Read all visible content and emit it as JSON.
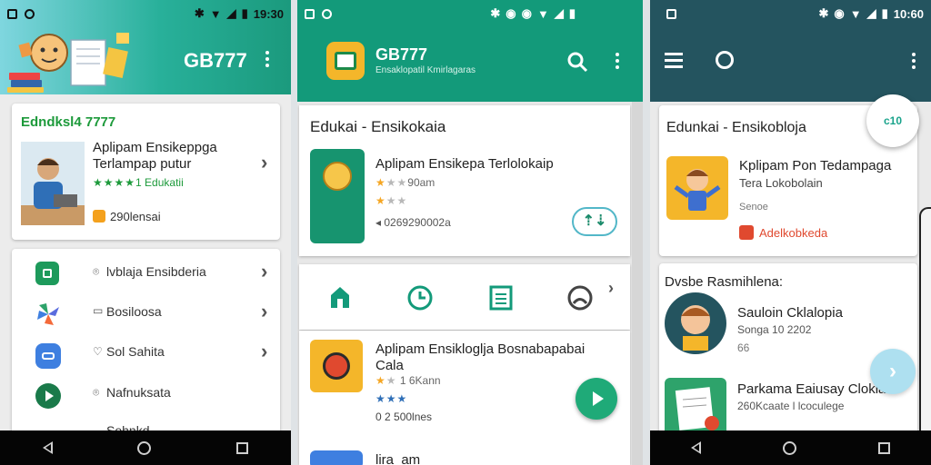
{
  "colors": {
    "teal": "#139a7a",
    "dark_teal": "#24545f",
    "green_text": "#1d9a3b",
    "star": "#f5a623",
    "fab": "#1faa78",
    "orange": "#f4a11d"
  },
  "p1": {
    "status": {
      "time": "19:30"
    },
    "header": {
      "title": "GB777",
      "icons": [
        "kid-reading-illustration",
        "more-vert-icon"
      ]
    },
    "featured": {
      "heading": "Edndksl4 7777",
      "app_title": "Aplipam Ensikeppga Terlampap putur",
      "stars_label": "1 Edukatii",
      "stars": 5,
      "info": "290lensai"
    },
    "list": [
      {
        "icon": "shopping-bag-icon",
        "color": "#1d9a5b",
        "label": "lvblaja Ensibderia"
      },
      {
        "icon": "pinwheel-icon",
        "color": "#5a6cde",
        "label": "Bosiloosa"
      },
      {
        "icon": "message-icon",
        "color": "#3e7fe0",
        "label": "Sol Sahita"
      },
      {
        "icon": "play-chat-icon",
        "color": "#1a7a4a",
        "label": "Nafnuksata"
      },
      {
        "label": "Sohnkd"
      }
    ]
  },
  "p2": {
    "status": {
      "time": ""
    },
    "header": {
      "title": "GB777",
      "subtitle": "Ensaklopatil Kmirlagaras"
    },
    "section_title": "Edukai - Ensikokaia",
    "featured_app": {
      "title": "Aplipam Ensikepa Terlolokaip",
      "stars_label": "90am",
      "stars": 2,
      "stars2": 3,
      "downloads": "0269290002a"
    },
    "tabs": [
      "home-icon",
      "clock-icon",
      "article-icon",
      "profile-icon"
    ],
    "apps": [
      {
        "title": "Aplipam Ensikloglja Bosnabapabai Cala",
        "rating_label": "6Kann",
        "stars": 2,
        "stars2": 3,
        "footer": "0 2 500lnes"
      },
      {
        "title": "lira_am",
        "stars": 0
      }
    ]
  },
  "p3": {
    "status": {
      "time": "10:60"
    },
    "section_title": "Edunkai - Ensikobloja",
    "featured_app": {
      "title": "Kplipam Pon Tedampaga",
      "subtitle": "Tera Lokobolain",
      "meta": "Senoe",
      "link": "Adelkobkeda"
    },
    "sub_section": "Dvsbe Rasmihlena:",
    "apps": [
      {
        "title": "Sauloin Cklalopia",
        "subtitle": "Songa 10 2202",
        "meta": "66"
      },
      {
        "title": "Parkama Eaiusay Clokla",
        "subtitle": "260Kcaate l lcoculege"
      }
    ],
    "fab_label": "c10"
  }
}
